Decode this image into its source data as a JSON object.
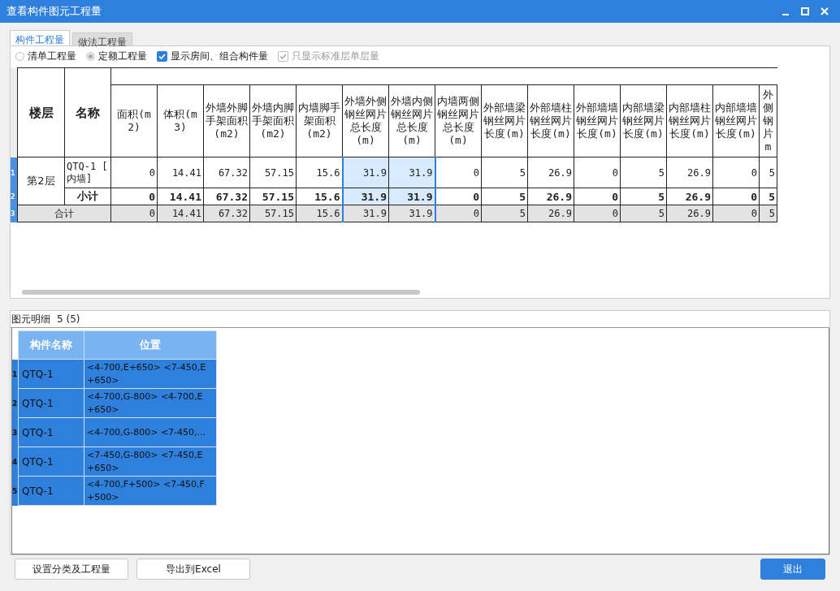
{
  "window": {
    "title": "查看构件图元工程量"
  },
  "tabs": [
    {
      "label": "构件工程量",
      "selected": true
    },
    {
      "label": "做法工程量",
      "selected": false
    }
  ],
  "options": [
    {
      "kind": "radio",
      "label": "清单工程量",
      "checked": false,
      "disabled": false
    },
    {
      "kind": "radio",
      "label": "定额工程量",
      "checked": true,
      "disabled": true
    },
    {
      "kind": "checkbox",
      "label": "显示房间、组合构件量",
      "checked": true,
      "disabled": false
    },
    {
      "kind": "checkbox",
      "label": "只显示标准层单层量",
      "checked": true,
      "disabled": true
    }
  ],
  "table": {
    "floor_header": "楼层",
    "name_header": "名称",
    "columns": [
      {
        "label": "面积(m2)",
        "selected": false
      },
      {
        "label": "体积(m3)",
        "selected": false
      },
      {
        "label": "外墙外脚手架面积(m2)",
        "selected": false
      },
      {
        "label": "外墙内脚手架面积(m2)",
        "selected": false
      },
      {
        "label": "内墙脚手架面积(m2)",
        "selected": false
      },
      {
        "label": "外墙外侧钢丝网片总长度(m)",
        "selected": true
      },
      {
        "label": "外墙内侧钢丝网片总长度(m)",
        "selected": true
      },
      {
        "label": "内墙两侧钢丝网片总长度(m)",
        "selected": false
      },
      {
        "label": "外部墙梁钢丝网片长度(m)",
        "selected": false
      },
      {
        "label": "外部墙柱钢丝网片长度(m)",
        "selected": false
      },
      {
        "label": "外部墙墙钢丝网片长度(m)",
        "selected": false
      },
      {
        "label": "内部墙梁钢丝网片长度(m)",
        "selected": false
      },
      {
        "label": "内部墙柱钢丝网片长度(m)",
        "selected": false
      },
      {
        "label": "内部墙墙钢丝网片长度(m)",
        "selected": false
      },
      {
        "label": "外侧钢片m",
        "selected": false
      }
    ],
    "rows": [
      {
        "num": "1",
        "kind": "item",
        "floor": "第2层",
        "name": "QTQ-1 [ 内墙]",
        "values": [
          "0",
          "14.41",
          "67.32",
          "57.15",
          "15.6",
          "31.9",
          "31.9",
          "0",
          "5",
          "26.9",
          "0",
          "5",
          "26.9",
          "0",
          "5"
        ]
      },
      {
        "num": "2",
        "kind": "subtotal",
        "name": "小计",
        "values": [
          "0",
          "14.41",
          "67.32",
          "57.15",
          "15.6",
          "31.9",
          "31.9",
          "0",
          "5",
          "26.9",
          "0",
          "5",
          "26.9",
          "0",
          "5"
        ]
      },
      {
        "num": "3",
        "kind": "total",
        "name": "合计",
        "values": [
          "0",
          "14.41",
          "67.32",
          "57.15",
          "15.6",
          "31.9",
          "31.9",
          "0",
          "5",
          "26.9",
          "0",
          "5",
          "26.9",
          "0",
          "5"
        ]
      }
    ]
  },
  "detail": {
    "title": "图元明细",
    "count": "5 (5)",
    "columns": [
      "构件名称",
      "位置"
    ],
    "rows": [
      {
        "num": "1",
        "name": "QTQ-1",
        "position": "<4-700,E+650> <7-450,E +650>",
        "selected": true
      },
      {
        "num": "2",
        "name": "QTQ-1",
        "position": "<4-700,G-800> <4-700,E +650>",
        "selected": true
      },
      {
        "num": "3",
        "name": "QTQ-1",
        "position": "<4-700,G-800> <7-450,...",
        "selected": true
      },
      {
        "num": "4",
        "name": "QTQ-1",
        "position": "<7-450,G-800> <7-450,E +650>",
        "selected": true
      },
      {
        "num": "5",
        "name": "QTQ-1",
        "position": "<4-700,F+500> <7-450,F +500>",
        "selected": true
      }
    ]
  },
  "buttons": [
    {
      "kind": "normal",
      "label": "设置分类及工程量"
    },
    {
      "kind": "normal",
      "label": "导出到Excel"
    },
    {
      "kind": "primary",
      "label": "退出"
    }
  ]
}
